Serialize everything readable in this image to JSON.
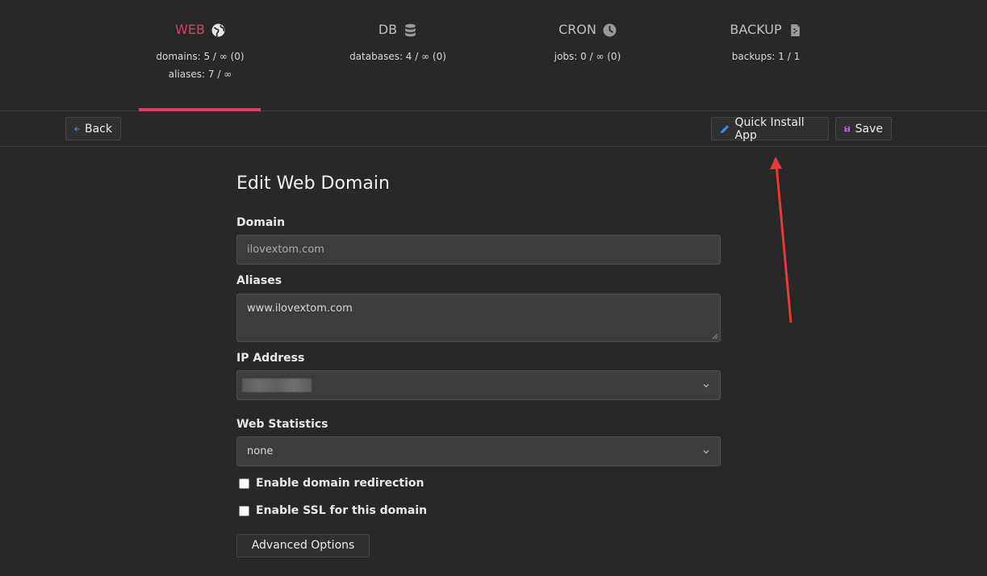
{
  "tabs": [
    {
      "title": "WEB",
      "icon": "globe-icon",
      "stats": [
        "domains: 5 / ∞ (0)",
        "aliases: 7 / ∞"
      ]
    },
    {
      "title": "DB",
      "icon": "database-icon",
      "stats": [
        "databases: 4 / ∞ (0)"
      ]
    },
    {
      "title": "CRON",
      "icon": "clock-icon",
      "stats": [
        "jobs: 0 / ∞ (0)"
      ]
    },
    {
      "title": "BACKUP",
      "icon": "file-icon",
      "stats": [
        "backups: 1 / 1"
      ]
    }
  ],
  "toolbar": {
    "back_label": "Back",
    "quick_install_label": "Quick Install App",
    "save_label": "Save"
  },
  "form": {
    "title": "Edit Web Domain",
    "domain_label": "Domain",
    "domain_value": "ilovextom.com",
    "aliases_label": "Aliases",
    "aliases_value": "www.ilovextom.com",
    "ip_label": "IP Address",
    "stats_label": "Web Statistics",
    "stats_value": "none",
    "redirect_label": "Enable domain redirection",
    "ssl_label": "Enable SSL for this domain",
    "advanced_label": "Advanced Options"
  },
  "colors": {
    "accent": "#e03a62",
    "background": "#282828",
    "annotation_arrow": "#e83a3a",
    "back_icon": "#3a8ee6",
    "edit_icon": "#3a8ee6",
    "save_icon": "#c05ce8"
  }
}
